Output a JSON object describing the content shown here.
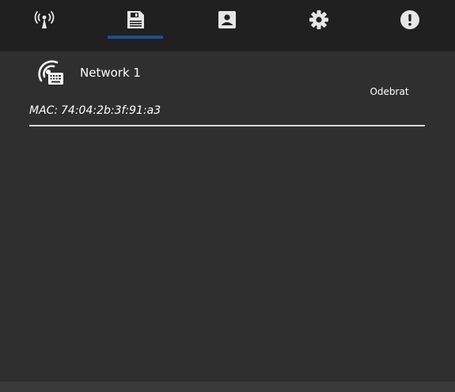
{
  "tabs": [
    {
      "name": "broadcast-tower-icon",
      "active": false
    },
    {
      "name": "save-icon",
      "active": true
    },
    {
      "name": "contact-card-icon",
      "active": false
    },
    {
      "name": "gear-icon",
      "active": false
    },
    {
      "name": "alert-icon",
      "active": false
    }
  ],
  "network": {
    "name": "Network 1",
    "icon": "wifi-device-icon",
    "remove_label": "Odebrat",
    "mac_prefix": "MAC:",
    "mac_value": "74:04:2b:3f:91:a3"
  },
  "colors": {
    "tabbar_bg": "#202020",
    "content_bg": "#2f2f2f",
    "accent": "#1e4f8c",
    "icon": "#e6e6e6",
    "text": "#ffffff"
  }
}
